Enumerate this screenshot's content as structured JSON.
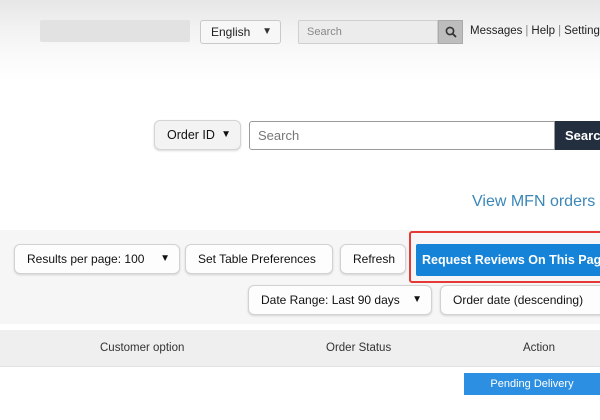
{
  "header": {
    "language": "English",
    "search_placeholder": "Search",
    "links": [
      "Messages",
      "Help",
      "Settings"
    ]
  },
  "order_search": {
    "filter_label": "Order ID",
    "placeholder": "Search",
    "button_label": "Search"
  },
  "mfn_link": "View MFN orders",
  "toolbar": {
    "results_per_page": "Results per page: 100",
    "table_preferences": "Set Table Preferences",
    "refresh": "Refresh",
    "request_reviews": "Request Reviews On This Page",
    "date_range": "Date Range: Last 90 days",
    "sort": "Order date (descending)"
  },
  "table": {
    "columns": [
      "Customer option",
      "Order Status",
      "Action"
    ],
    "rows": [
      {
        "action": "Pending Delivery"
      }
    ]
  },
  "colors": {
    "primary_button": "#1583d8",
    "highlight_border": "#e53935",
    "link": "#3a87b8",
    "dark_button": "#232f3e"
  }
}
